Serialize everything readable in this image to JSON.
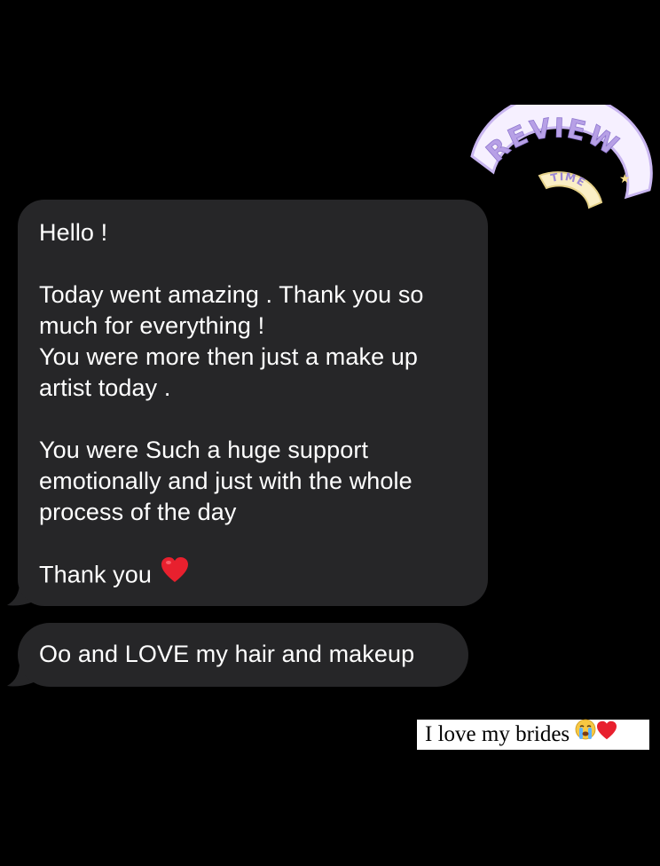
{
  "sticker": {
    "word": "REVIEW",
    "sub": "TIME",
    "colors": {
      "ring": "#f6f0ff",
      "ring_edge": "#c9b6f0",
      "letters": "#b7a0e6",
      "sub_fill": "#fbefc6",
      "sub_text": "#9b86d6",
      "star": "#f7e08a"
    }
  },
  "messages": [
    {
      "lines": [
        "Hello !",
        "",
        "Today went amazing . Thank you so",
        "much for everything !",
        "You were more then just a make up",
        "artist today .",
        "",
        "You were Such a huge support",
        "emotionally and just with the whole",
        "process of the day",
        ""
      ],
      "last_line": "Thank you",
      "emoji": "red-heart"
    },
    {
      "text": "Oo and LOVE my hair and makeup"
    }
  ],
  "caption": {
    "text": "I love my brides",
    "emojis": [
      "crying-face",
      "red-heart"
    ]
  },
  "colors": {
    "background": "#000000",
    "bubble": "#262628",
    "text": "#ffffff",
    "heart": "#e8202e"
  }
}
